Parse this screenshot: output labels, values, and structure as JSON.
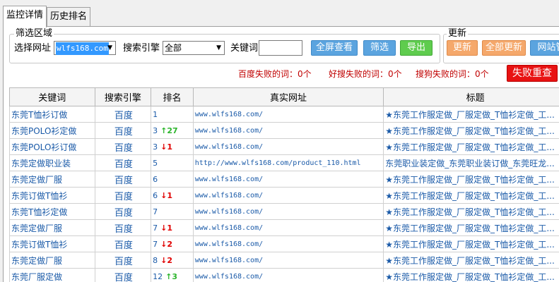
{
  "tabs": [
    {
      "label": "监控详情",
      "active": true
    },
    {
      "label": "历史排名",
      "active": false
    }
  ],
  "filter": {
    "legend": "筛选区域",
    "site_label": "选择网址",
    "site_value": "wlfs168.com",
    "engine_label": "搜索引擎",
    "engine_value": "全部",
    "keyword_label": "关键词",
    "keyword_value": "",
    "btn_fullscreen": "全屏查看",
    "btn_filter": "筛选",
    "btn_export": "导出"
  },
  "update": {
    "legend": "更新",
    "btn_update": "更新",
    "btn_update_all": "全部更新",
    "btn_site": "网站管"
  },
  "fail_stats": {
    "baidu": "百度失败的词：0个",
    "haosou": "好搜失败的词：0个",
    "sogou": "搜狗失败的词：0个",
    "retry_button": "失败重查"
  },
  "table": {
    "headers": [
      "关键词",
      "搜索引擎",
      "排名",
      "真实网址",
      "标题"
    ],
    "rows": [
      {
        "keyword": "东莞T恤衫订做",
        "engine": "百度",
        "rank": "1",
        "change": "",
        "dir": "",
        "url": "www.wlfs168.com/",
        "title": "★东莞工作服定做_厂服定做_T恤衫定做_工..."
      },
      {
        "keyword": "东莞POLO衫定做",
        "engine": "百度",
        "rank": "3",
        "change": "27",
        "dir": "up",
        "url": "www.wlfs168.com/",
        "title": "★东莞工作服定做_厂服定做_T恤衫定做_工..."
      },
      {
        "keyword": "东莞POLO衫订做",
        "engine": "百度",
        "rank": "3",
        "change": "1",
        "dir": "down",
        "url": "www.wlfs168.com/",
        "title": "★东莞工作服定做_厂服定做_T恤衫定做_工..."
      },
      {
        "keyword": "东莞定做职业装",
        "engine": "百度",
        "rank": "5",
        "change": "",
        "dir": "",
        "url": "http://www.wlfs168.com/product_110.html",
        "title": "东莞职业装定做_东莞职业装订做_东莞旺龙..."
      },
      {
        "keyword": "东莞定做厂服",
        "engine": "百度",
        "rank": "6",
        "change": "",
        "dir": "",
        "url": "www.wlfs168.com/",
        "title": "★东莞工作服定做_厂服定做_T恤衫定做_工..."
      },
      {
        "keyword": "东莞订做T恤衫",
        "engine": "百度",
        "rank": "6",
        "change": "1",
        "dir": "down",
        "url": "www.wlfs168.com/",
        "title": "★东莞工作服定做_厂服定做_T恤衫定做_工..."
      },
      {
        "keyword": "东莞T恤衫定做",
        "engine": "百度",
        "rank": "7",
        "change": "",
        "dir": "",
        "url": "www.wlfs168.com/",
        "title": "★东莞工作服定做_厂服定做_T恤衫定做_工..."
      },
      {
        "keyword": "东莞定做厂服",
        "engine": "百度",
        "rank": "7",
        "change": "1",
        "dir": "down",
        "url": "www.wlfs168.com/",
        "title": "★东莞工作服定做_厂服定做_T恤衫定做_工..."
      },
      {
        "keyword": "东莞订做T恤衫",
        "engine": "百度",
        "rank": "7",
        "change": "2",
        "dir": "down",
        "url": "www.wlfs168.com/",
        "title": "★东莞工作服定做_厂服定做_T恤衫定做_工..."
      },
      {
        "keyword": "东莞定做厂服",
        "engine": "百度",
        "rank": "8",
        "change": "2",
        "dir": "down",
        "url": "www.wlfs168.com/",
        "title": "★东莞工作服定做_厂服定做_T恤衫定做_工..."
      },
      {
        "keyword": "东莞厂服定做",
        "engine": "百度",
        "rank": "12",
        "change": "3",
        "dir": "up",
        "url": "www.wlfs168.com/",
        "title": "★东莞工作服定做_厂服定做_T恤衫定做_工..."
      }
    ]
  },
  "icons": {
    "up": "arrow-up-icon",
    "down": "arrow-down-icon",
    "dropdown": "chevron-down-icon"
  },
  "colors": {
    "up": "#2db52d",
    "down": "#e00000",
    "link": "#1a5aa8",
    "retry": "#e81212"
  }
}
